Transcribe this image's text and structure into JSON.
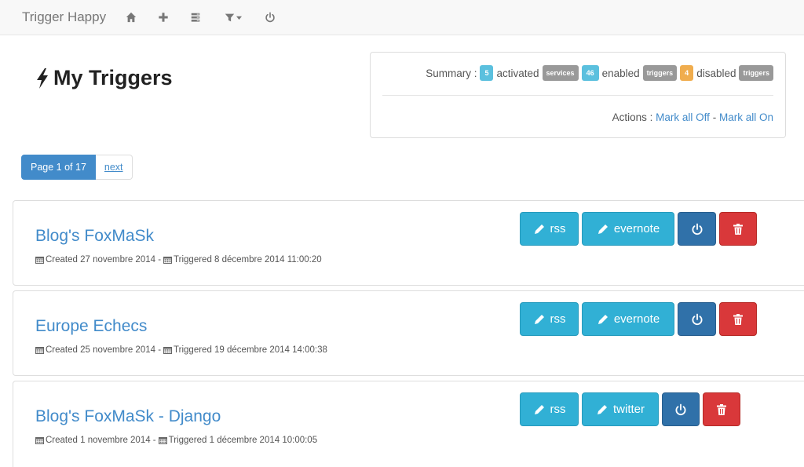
{
  "navbar": {
    "brand": "Trigger Happy",
    "icons": [
      "home-icon",
      "plus-icon",
      "list-icon",
      "filter-icon",
      "power-icon"
    ]
  },
  "header": {
    "title": "My Triggers"
  },
  "summary": {
    "label": "Summary :",
    "activated_count": "5",
    "activated_label": "activated",
    "services_tag": "services",
    "enabled_count": "46",
    "enabled_label": "enabled",
    "triggers_tag": "triggers",
    "disabled_count": "4",
    "disabled_label": "disabled",
    "disabled_tag": "triggers",
    "actions_label": "Actions :",
    "mark_all_off": "Mark all Off",
    "dash": "-",
    "mark_all_on": "Mark all On"
  },
  "pagination": {
    "current": "Page 1 of 17",
    "next": "next"
  },
  "triggers": [
    {
      "title": "Blog's FoxMaSk",
      "created": "Created 27 novembre 2014 -",
      "triggered": "Triggered 8 décembre 2014 11:00:20",
      "provider": "rss",
      "consumer": "evernote"
    },
    {
      "title": "Europe Echecs",
      "created": "Created 25 novembre 2014 -",
      "triggered": "Triggered 19 décembre 2014 14:00:38",
      "provider": "rss",
      "consumer": "evernote"
    },
    {
      "title": "Blog's FoxMaSk - Django",
      "created": "Created 1 novembre 2014 -",
      "triggered": "Triggered 1 décembre 2014 10:00:05",
      "provider": "rss",
      "consumer": "twitter"
    }
  ],
  "colors": {
    "link": "#428bca",
    "info": "#31b0d5",
    "primary": "#3071a9",
    "danger": "#d9383a",
    "warning": "#f0ad4e"
  }
}
